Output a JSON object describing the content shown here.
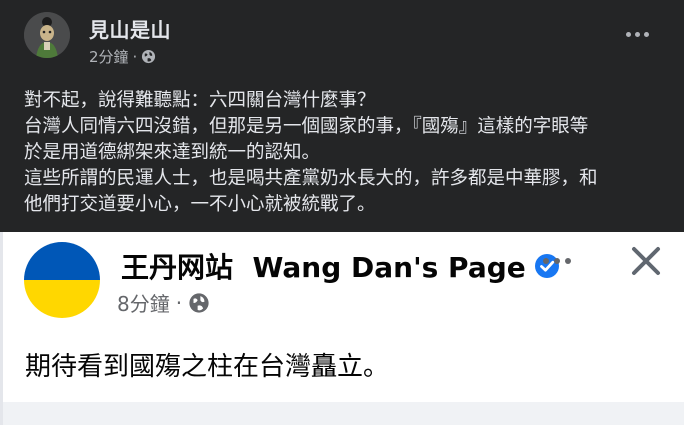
{
  "outer_post": {
    "author": "見山是山",
    "timestamp": "2分鐘",
    "separator": "·",
    "audience_icon": "globe-icon",
    "more_icon": "more-options-icon",
    "lines": [
      "對不起，說得難聽點：六四關台灣什麼事？",
      "台灣人同情六四沒錯，但那是另一個國家的事，『國殤』這樣的字眼等",
      "於是用道德綁架來達到統一的認知。",
      "這些所謂的民運人士，也是喝共產黨奶水長大的，許多都是中華膠，和",
      "他們打交道要小心，一不小心就被統戰了。"
    ]
  },
  "shared_post": {
    "page_name": "王丹网站  Wang Dan's Page",
    "verified_icon": "verified-badge-icon",
    "timestamp": "8分鐘",
    "separator": "·",
    "audience_icon": "globe-icon",
    "more_icon": "more-options-icon",
    "close_icon": "close-icon",
    "text": "期待看到國殤之柱在台灣矗立。"
  },
  "colors": {
    "dark_bg": "#242526",
    "dark_text": "#e4e6eb",
    "dark_secondary": "#b0b3b8",
    "light_text": "#050505",
    "light_secondary": "#65676b",
    "verified_blue": "#1877f2",
    "flag_blue": "#0057b7",
    "flag_yellow": "#ffd700"
  }
}
